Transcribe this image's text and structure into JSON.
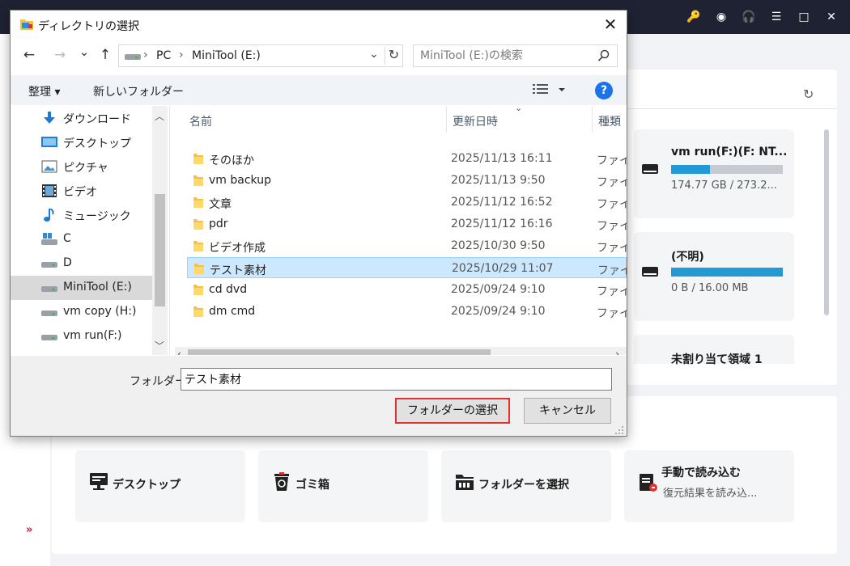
{
  "app": {
    "window_controls": [
      {
        "name": "key-icon",
        "glyph": "🔑"
      },
      {
        "name": "disc-icon",
        "glyph": "◉"
      },
      {
        "name": "headset-icon",
        "glyph": "🎧"
      },
      {
        "name": "menu-icon",
        "glyph": "☰"
      },
      {
        "name": "minimize-icon",
        "glyph": "□"
      },
      {
        "name": "close-icon",
        "glyph": "✕"
      }
    ],
    "refresh_glyph": "↻",
    "expand_glyph": "»",
    "drives": [
      {
        "name": "vm run(F:)(F: NT...",
        "size": "174.77 GB / 273.2...",
        "used_fraction": 0.35
      },
      {
        "name": "(不明)",
        "size": "0 B / 16.00 MB",
        "used_fraction": 1.0
      },
      {
        "name": "未割り当て領域 1",
        "size": "",
        "used_fraction": null
      }
    ],
    "locations": [
      {
        "label": "デスクトップ",
        "icon": "desktop-icon"
      },
      {
        "label": "ゴミ箱",
        "icon": "recycle-bin-icon"
      },
      {
        "label": "フォルダーを選択",
        "icon": "folder-select-icon"
      },
      {
        "label": "手動で読み込む",
        "sub": "復元結果を読み込...",
        "icon": "load-file-icon"
      }
    ],
    "accent_color": "#239ad5"
  },
  "dialog": {
    "title": "ディレクトリの選択",
    "close_glyph": "✕",
    "nav": {
      "back": "←",
      "forward": "→",
      "recent": "⌄",
      "up": "↑"
    },
    "address": {
      "segments": [
        "PC",
        "MiniTool (E:)"
      ],
      "separator": "›"
    },
    "search_placeholder": "MiniTool (E:)の検索",
    "toolbar": {
      "organize": "整理 ▾",
      "new_folder": "新しいフォルダー",
      "help": "?"
    },
    "tree": [
      {
        "label": "ダウンロード",
        "icon": "download-icon"
      },
      {
        "label": "デスクトップ",
        "icon": "desktop-folder-icon"
      },
      {
        "label": "ピクチャ",
        "icon": "pictures-icon"
      },
      {
        "label": "ビデオ",
        "icon": "videos-icon"
      },
      {
        "label": "ミュージック",
        "icon": "music-icon"
      },
      {
        "label": "C",
        "icon": "windows-drive-icon"
      },
      {
        "label": "D",
        "icon": "drive-icon"
      },
      {
        "label": "MiniTool (E:)",
        "icon": "drive-icon",
        "selected": true
      },
      {
        "label": "vm copy (H:)",
        "icon": "drive-icon"
      },
      {
        "label": "vm run(F:)",
        "icon": "drive-icon"
      }
    ],
    "columns": {
      "name": "名前",
      "date": "更新日時",
      "type": "種類"
    },
    "files": [
      {
        "name": "そのほか",
        "date": "2025/11/13 16:11",
        "type": "ファイル"
      },
      {
        "name": "vm backup",
        "date": "2025/11/13 9:50",
        "type": "ファイル"
      },
      {
        "name": "文章",
        "date": "2025/11/12 16:52",
        "type": "ファイル"
      },
      {
        "name": "pdr",
        "date": "2025/11/12 16:16",
        "type": "ファイル"
      },
      {
        "name": "ビデオ作成",
        "date": "2025/10/30 9:50",
        "type": "ファイル"
      },
      {
        "name": "テスト素材",
        "date": "2025/10/29 11:07",
        "type": "ファイル",
        "selected": true
      },
      {
        "name": "cd dvd",
        "date": "2025/09/24 9:10",
        "type": "ファイル"
      },
      {
        "name": "dm cmd",
        "date": "2025/09/24 9:10",
        "type": "ファイル"
      }
    ],
    "folder_label": "フォルダー:",
    "folder_value": "テスト素材",
    "select_button": "フォルダーの選択",
    "cancel_button": "キャンセル"
  }
}
